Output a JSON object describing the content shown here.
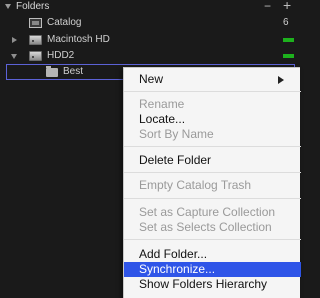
{
  "panel": {
    "title": "Folders",
    "remove_label": "−",
    "add_label": "+"
  },
  "tree": {
    "catalog": {
      "label": "Catalog",
      "count": "6"
    },
    "macintosh_hd": {
      "label": "Macintosh HD",
      "space_color": "#1db11d"
    },
    "hdd2": {
      "label": "HDD2",
      "space_color": "#1db11d"
    },
    "best": {
      "label": "Best"
    }
  },
  "selection_color": "#5c62d6",
  "context_menu": {
    "highlight_color": "#2f55e8",
    "items": {
      "new": "New",
      "rename": "Rename",
      "locate": "Locate...",
      "sort_by_name": "Sort By Name",
      "delete_folder": "Delete Folder",
      "empty_catalog_trash": "Empty Catalog Trash",
      "set_capture": "Set as Capture Collection",
      "set_selects": "Set as Selects Collection",
      "add_folder": "Add Folder...",
      "synchronize": "Synchronize...",
      "show_hierarchy": "Show Folders Hierarchy"
    }
  }
}
